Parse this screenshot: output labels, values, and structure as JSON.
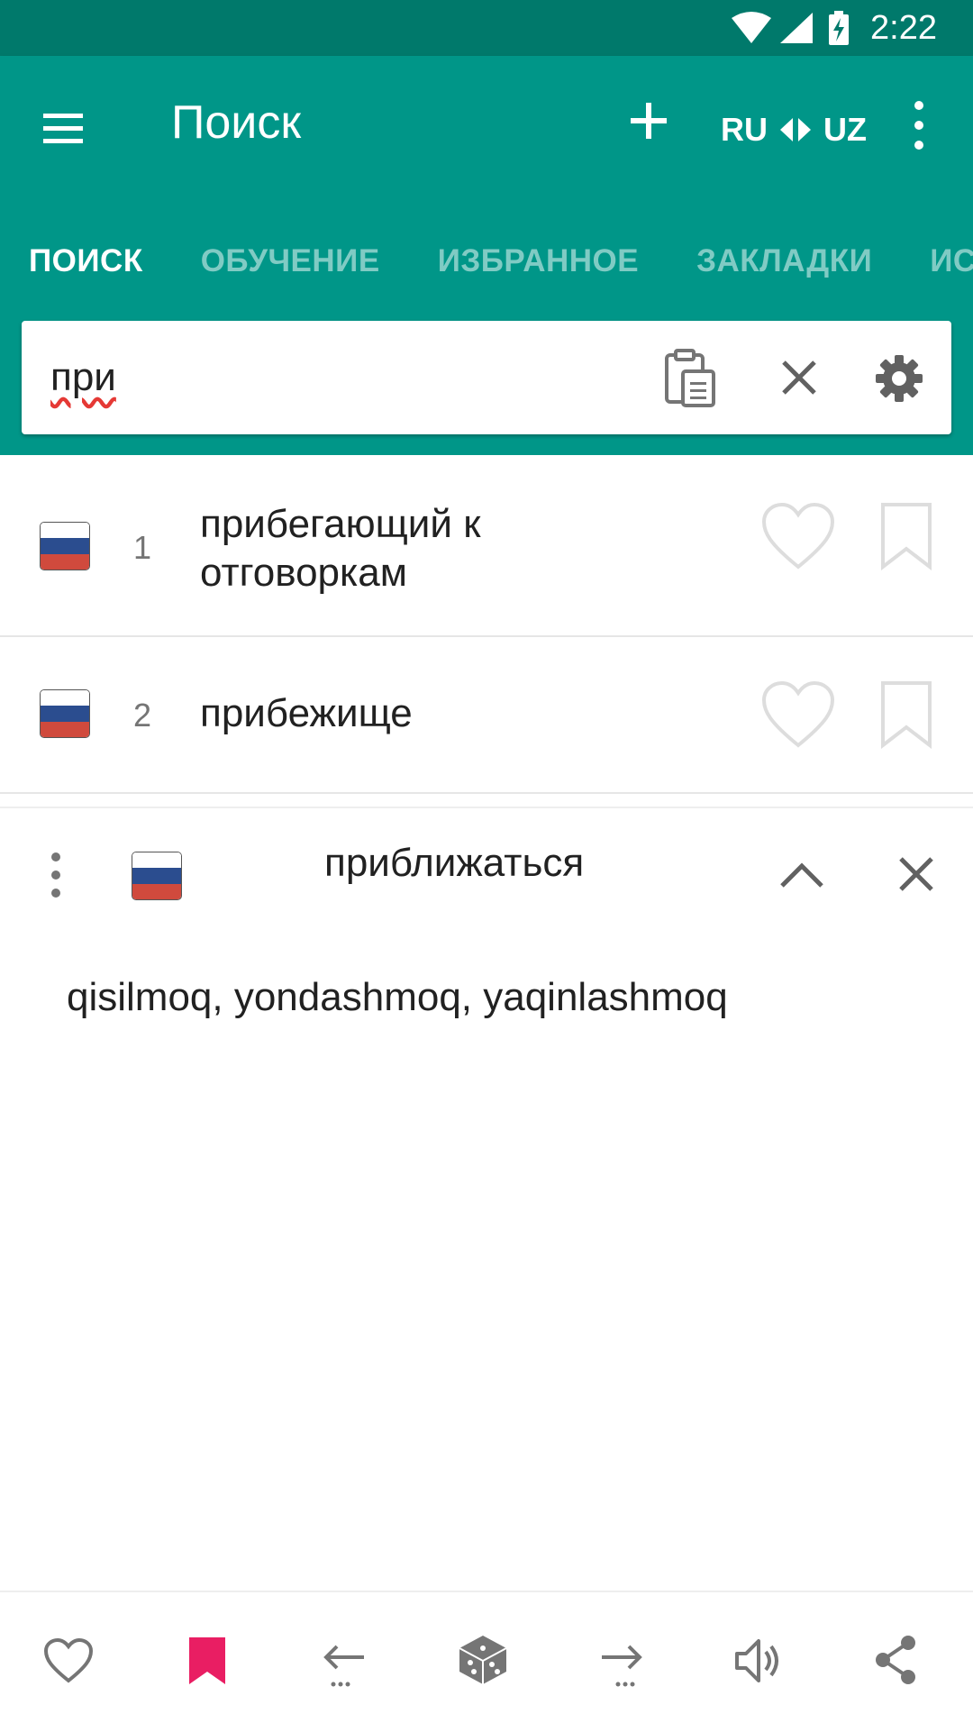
{
  "status_bar": {
    "time": "2:22"
  },
  "app_bar": {
    "title": "Поиск",
    "lang_from": "RU",
    "lang_to": "UZ"
  },
  "tabs": [
    {
      "label": "ПОИСК",
      "active": true
    },
    {
      "label": "ОБУЧЕНИЕ",
      "active": false
    },
    {
      "label": "ИЗБРАННОЕ",
      "active": false
    },
    {
      "label": "ЗАКЛАДКИ",
      "active": false
    },
    {
      "label": "ИСТ",
      "active": false
    }
  ],
  "search": {
    "value": "при"
  },
  "results": [
    {
      "number": "1",
      "line1": "прибегающий к",
      "line2": "отговоркам",
      "flag": "ru-flag-icon"
    },
    {
      "number": "2",
      "line1": "прибежище",
      "flag": "ru-flag-icon"
    }
  ],
  "detail": {
    "word": "приближаться",
    "translation": "qisilmoq, yondashmoq, yaqinlashmoq"
  },
  "colors": {
    "primary": "#009688",
    "status_bar": "#00796b",
    "tab_inactive": "#80cbc4",
    "bookmark_active": "#e91e63",
    "icon_gray": "#757575"
  },
  "icons": {
    "status": [
      "wifi-icon",
      "signal-icon",
      "battery-charging-icon"
    ],
    "app_bar": [
      "menu-icon",
      "plus-icon",
      "swap-arrows-icon",
      "more-vert-icon"
    ],
    "search": [
      "clipboard-icon",
      "close-icon",
      "gear-icon"
    ],
    "row": [
      "heart-icon",
      "bookmark-icon"
    ],
    "bottom_bar": [
      "heart-icon",
      "bookmark-icon",
      "arrow-left-icon",
      "dice-icon",
      "arrow-right-icon",
      "speaker-icon",
      "share-icon"
    ]
  }
}
